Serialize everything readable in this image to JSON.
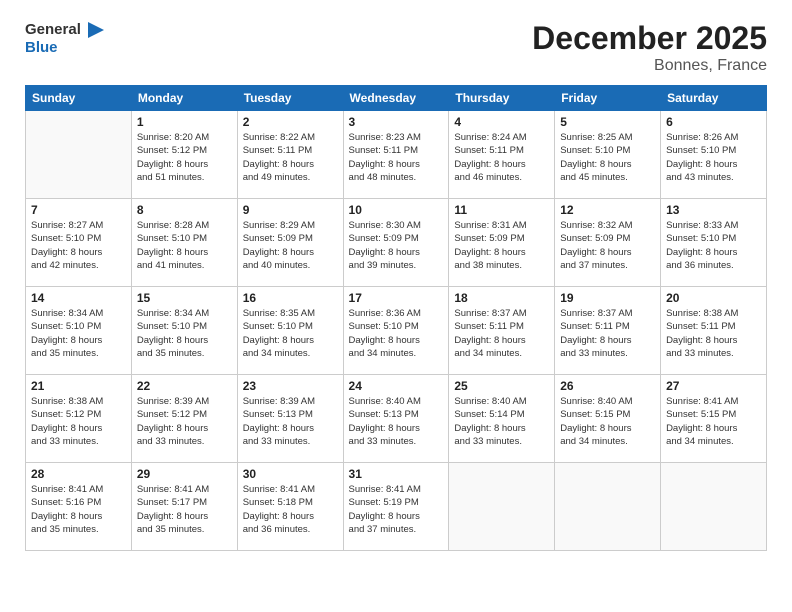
{
  "header": {
    "logo_line1": "General",
    "logo_line2": "Blue",
    "title": "December 2025",
    "subtitle": "Bonnes, France"
  },
  "days_of_week": [
    "Sunday",
    "Monday",
    "Tuesday",
    "Wednesday",
    "Thursday",
    "Friday",
    "Saturday"
  ],
  "weeks": [
    [
      {
        "day": "",
        "info": ""
      },
      {
        "day": "1",
        "info": "Sunrise: 8:20 AM\nSunset: 5:12 PM\nDaylight: 8 hours\nand 51 minutes."
      },
      {
        "day": "2",
        "info": "Sunrise: 8:22 AM\nSunset: 5:11 PM\nDaylight: 8 hours\nand 49 minutes."
      },
      {
        "day": "3",
        "info": "Sunrise: 8:23 AM\nSunset: 5:11 PM\nDaylight: 8 hours\nand 48 minutes."
      },
      {
        "day": "4",
        "info": "Sunrise: 8:24 AM\nSunset: 5:11 PM\nDaylight: 8 hours\nand 46 minutes."
      },
      {
        "day": "5",
        "info": "Sunrise: 8:25 AM\nSunset: 5:10 PM\nDaylight: 8 hours\nand 45 minutes."
      },
      {
        "day": "6",
        "info": "Sunrise: 8:26 AM\nSunset: 5:10 PM\nDaylight: 8 hours\nand 43 minutes."
      }
    ],
    [
      {
        "day": "7",
        "info": "Sunrise: 8:27 AM\nSunset: 5:10 PM\nDaylight: 8 hours\nand 42 minutes."
      },
      {
        "day": "8",
        "info": "Sunrise: 8:28 AM\nSunset: 5:10 PM\nDaylight: 8 hours\nand 41 minutes."
      },
      {
        "day": "9",
        "info": "Sunrise: 8:29 AM\nSunset: 5:09 PM\nDaylight: 8 hours\nand 40 minutes."
      },
      {
        "day": "10",
        "info": "Sunrise: 8:30 AM\nSunset: 5:09 PM\nDaylight: 8 hours\nand 39 minutes."
      },
      {
        "day": "11",
        "info": "Sunrise: 8:31 AM\nSunset: 5:09 PM\nDaylight: 8 hours\nand 38 minutes."
      },
      {
        "day": "12",
        "info": "Sunrise: 8:32 AM\nSunset: 5:09 PM\nDaylight: 8 hours\nand 37 minutes."
      },
      {
        "day": "13",
        "info": "Sunrise: 8:33 AM\nSunset: 5:10 PM\nDaylight: 8 hours\nand 36 minutes."
      }
    ],
    [
      {
        "day": "14",
        "info": "Sunrise: 8:34 AM\nSunset: 5:10 PM\nDaylight: 8 hours\nand 35 minutes."
      },
      {
        "day": "15",
        "info": "Sunrise: 8:34 AM\nSunset: 5:10 PM\nDaylight: 8 hours\nand 35 minutes."
      },
      {
        "day": "16",
        "info": "Sunrise: 8:35 AM\nSunset: 5:10 PM\nDaylight: 8 hours\nand 34 minutes."
      },
      {
        "day": "17",
        "info": "Sunrise: 8:36 AM\nSunset: 5:10 PM\nDaylight: 8 hours\nand 34 minutes."
      },
      {
        "day": "18",
        "info": "Sunrise: 8:37 AM\nSunset: 5:11 PM\nDaylight: 8 hours\nand 34 minutes."
      },
      {
        "day": "19",
        "info": "Sunrise: 8:37 AM\nSunset: 5:11 PM\nDaylight: 8 hours\nand 33 minutes."
      },
      {
        "day": "20",
        "info": "Sunrise: 8:38 AM\nSunset: 5:11 PM\nDaylight: 8 hours\nand 33 minutes."
      }
    ],
    [
      {
        "day": "21",
        "info": "Sunrise: 8:38 AM\nSunset: 5:12 PM\nDaylight: 8 hours\nand 33 minutes."
      },
      {
        "day": "22",
        "info": "Sunrise: 8:39 AM\nSunset: 5:12 PM\nDaylight: 8 hours\nand 33 minutes."
      },
      {
        "day": "23",
        "info": "Sunrise: 8:39 AM\nSunset: 5:13 PM\nDaylight: 8 hours\nand 33 minutes."
      },
      {
        "day": "24",
        "info": "Sunrise: 8:40 AM\nSunset: 5:13 PM\nDaylight: 8 hours\nand 33 minutes."
      },
      {
        "day": "25",
        "info": "Sunrise: 8:40 AM\nSunset: 5:14 PM\nDaylight: 8 hours\nand 33 minutes."
      },
      {
        "day": "26",
        "info": "Sunrise: 8:40 AM\nSunset: 5:15 PM\nDaylight: 8 hours\nand 34 minutes."
      },
      {
        "day": "27",
        "info": "Sunrise: 8:41 AM\nSunset: 5:15 PM\nDaylight: 8 hours\nand 34 minutes."
      }
    ],
    [
      {
        "day": "28",
        "info": "Sunrise: 8:41 AM\nSunset: 5:16 PM\nDaylight: 8 hours\nand 35 minutes."
      },
      {
        "day": "29",
        "info": "Sunrise: 8:41 AM\nSunset: 5:17 PM\nDaylight: 8 hours\nand 35 minutes."
      },
      {
        "day": "30",
        "info": "Sunrise: 8:41 AM\nSunset: 5:18 PM\nDaylight: 8 hours\nand 36 minutes."
      },
      {
        "day": "31",
        "info": "Sunrise: 8:41 AM\nSunset: 5:19 PM\nDaylight: 8 hours\nand 37 minutes."
      },
      {
        "day": "",
        "info": ""
      },
      {
        "day": "",
        "info": ""
      },
      {
        "day": "",
        "info": ""
      }
    ]
  ]
}
